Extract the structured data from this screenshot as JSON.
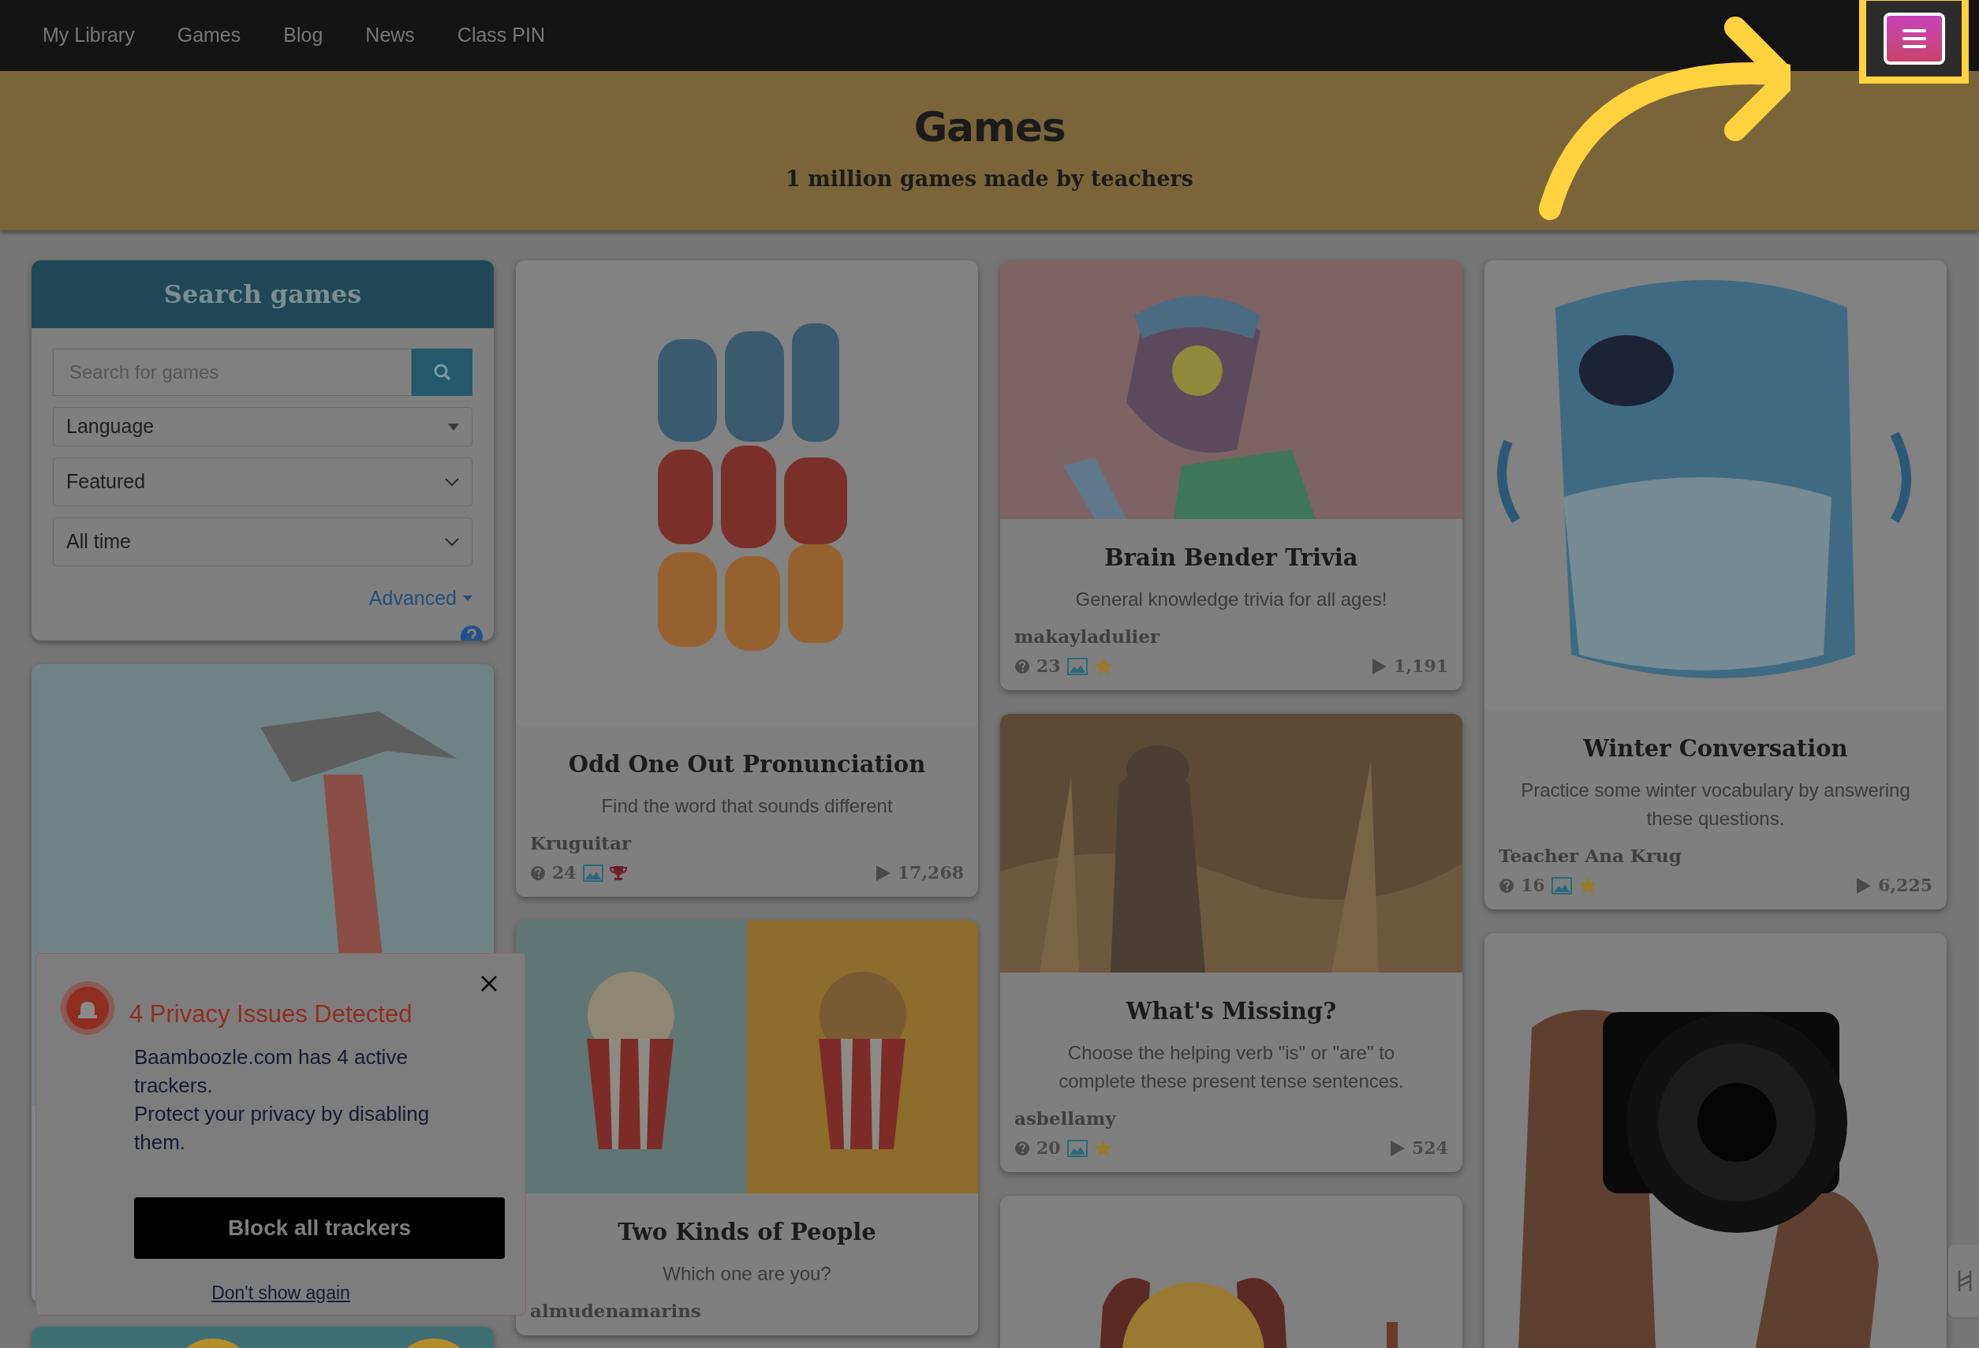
{
  "nav": {
    "items": [
      {
        "label": "My Library"
      },
      {
        "label": "Games"
      },
      {
        "label": "Blog"
      },
      {
        "label": "News"
      },
      {
        "label": "Class PIN"
      }
    ]
  },
  "banner": {
    "title": "Games",
    "subtitle": "1 million games made by teachers"
  },
  "search": {
    "title": "Search games",
    "placeholder": "Search for games",
    "selects": [
      {
        "value": "Language",
        "kind": "triangle"
      },
      {
        "value": "Featured",
        "kind": "chevron"
      },
      {
        "value": "All time",
        "kind": "chevron"
      }
    ],
    "advanced": "Advanced"
  },
  "columns": [
    {
      "cards": [
        {
          "kind": "picture"
        },
        {
          "kind": "picture"
        }
      ]
    },
    {
      "cards": [
        {
          "kind": "game",
          "title": "Odd One Out Pronunciation",
          "description": "Find the word that sounds different",
          "author": "Kruguitar",
          "questions": "24",
          "award": {
            "kind": "trophy"
          },
          "plays": "17,268"
        },
        {
          "kind": "game",
          "title": "Two Kinds of People",
          "description": "Which one are you?",
          "author": "almudenamarins"
        }
      ]
    },
    {
      "cards": [
        {
          "kind": "game",
          "title": "Brain Bender Trivia",
          "description": "General knowledge trivia for all ages!",
          "author": "makayladulier",
          "questions": "23",
          "award": {
            "kind": "star"
          },
          "plays": "1,191"
        },
        {
          "kind": "game",
          "title": "What's Missing?",
          "description": "Choose the helping verb \"is\" or \"are\" to complete these present tense sentences.",
          "author": "asbellamy",
          "questions": "20",
          "award": {
            "kind": "star"
          },
          "plays": "524"
        },
        {
          "kind": "picture"
        }
      ]
    },
    {
      "cards": [
        {
          "kind": "game",
          "title": "Winter Conversation",
          "description": "Practice some winter vocabulary by answering these questions.",
          "author": "Teacher Ana Krug",
          "questions": "16",
          "award": {
            "kind": "star"
          },
          "plays": "6,225"
        },
        {
          "kind": "picture"
        }
      ]
    }
  ],
  "popup": {
    "title": "4 Privacy Issues Detected",
    "lines": [
      "Baamboozle.com has 4 active trackers.",
      "Protect your privacy by disabling them."
    ],
    "button": "Block all trackers",
    "link": "Don't show again"
  }
}
